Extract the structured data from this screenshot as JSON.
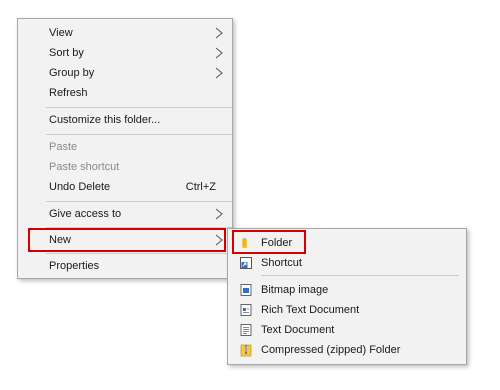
{
  "context_menu": {
    "items": {
      "view": {
        "label": "View",
        "has_submenu": true
      },
      "sort_by": {
        "label": "Sort by",
        "has_submenu": true
      },
      "group_by": {
        "label": "Group by",
        "has_submenu": true
      },
      "refresh": {
        "label": "Refresh"
      },
      "customize": {
        "label": "Customize this folder..."
      },
      "paste": {
        "label": "Paste",
        "enabled": false
      },
      "paste_shortcut": {
        "label": "Paste shortcut",
        "enabled": false
      },
      "undo_delete": {
        "label": "Undo Delete",
        "shortcut": "Ctrl+Z"
      },
      "give_access": {
        "label": "Give access to",
        "has_submenu": true
      },
      "new": {
        "label": "New",
        "has_submenu": true,
        "highlighted": true
      },
      "properties": {
        "label": "Properties"
      }
    }
  },
  "new_submenu": {
    "items": {
      "folder": {
        "label": "Folder",
        "icon": "folder-icon",
        "highlighted": true
      },
      "shortcut": {
        "label": "Shortcut",
        "icon": "shortcut-icon"
      },
      "bitmap": {
        "label": "Bitmap image",
        "icon": "bitmap-icon"
      },
      "rtf": {
        "label": "Rich Text Document",
        "icon": "rich-text-document-icon"
      },
      "text": {
        "label": "Text Document",
        "icon": "text-document-icon"
      },
      "zip": {
        "label": "Compressed (zipped) Folder",
        "icon": "zip-folder-icon"
      }
    }
  },
  "colors": {
    "highlight_border": "#d40000",
    "menu_background": "#f2f2f2",
    "disabled_text": "#8a8a8a"
  }
}
